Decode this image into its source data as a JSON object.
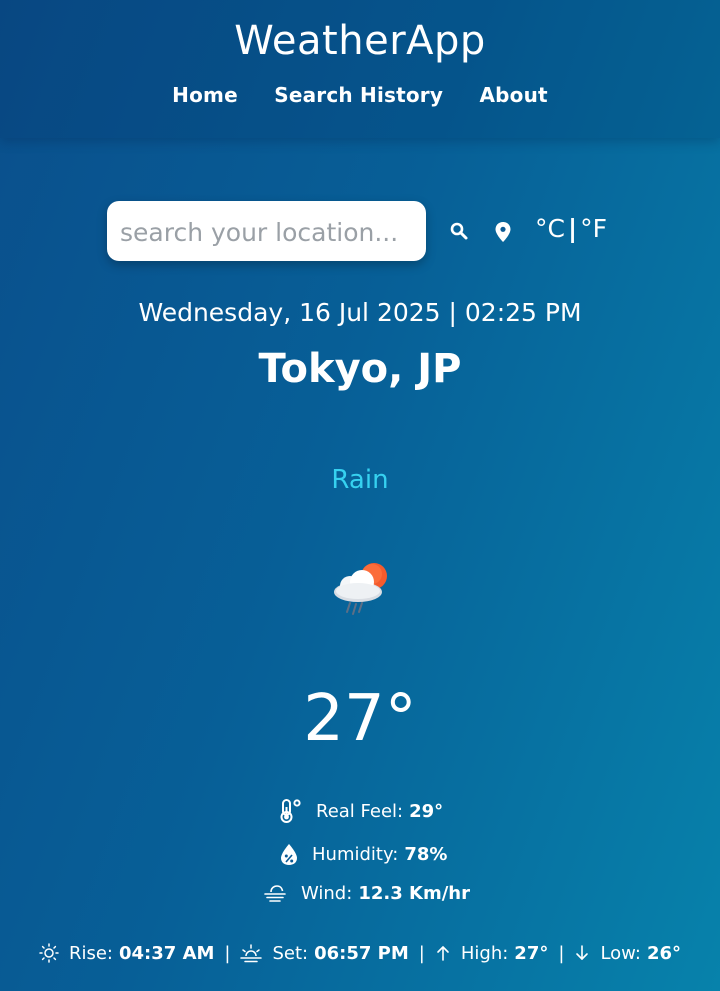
{
  "header": {
    "title": "WeatherApp",
    "nav": [
      "Home",
      "Search History",
      "About"
    ]
  },
  "search": {
    "placeholder": "search your location...",
    "unit_c": "°C",
    "unit_sep": "|",
    "unit_f": "°F"
  },
  "current": {
    "datetime": "Wednesday, 16 Jul 2025 | 02:25 PM",
    "location": "Tokyo, JP",
    "condition": "Rain",
    "temperature": "27°",
    "icon": "rain-cloud-sun-icon"
  },
  "details": {
    "real_feel_label": "Real Feel:",
    "real_feel_value": "29°",
    "humidity_label": "Humidity:",
    "humidity_value": "78%",
    "wind_label": "Wind:",
    "wind_value": "12.3 Km/hr"
  },
  "footer": {
    "rise_label": "Rise:",
    "rise_value": "04:37 AM",
    "set_label": "Set:",
    "set_value": "06:57 PM",
    "high_label": "High:",
    "high_value": "27°",
    "low_label": "Low:",
    "low_value": "26°",
    "separator": "|"
  },
  "colors": {
    "accent_condition": "#36d1f0",
    "background_start": "#0a4f8c",
    "background_end": "#0782ab"
  }
}
